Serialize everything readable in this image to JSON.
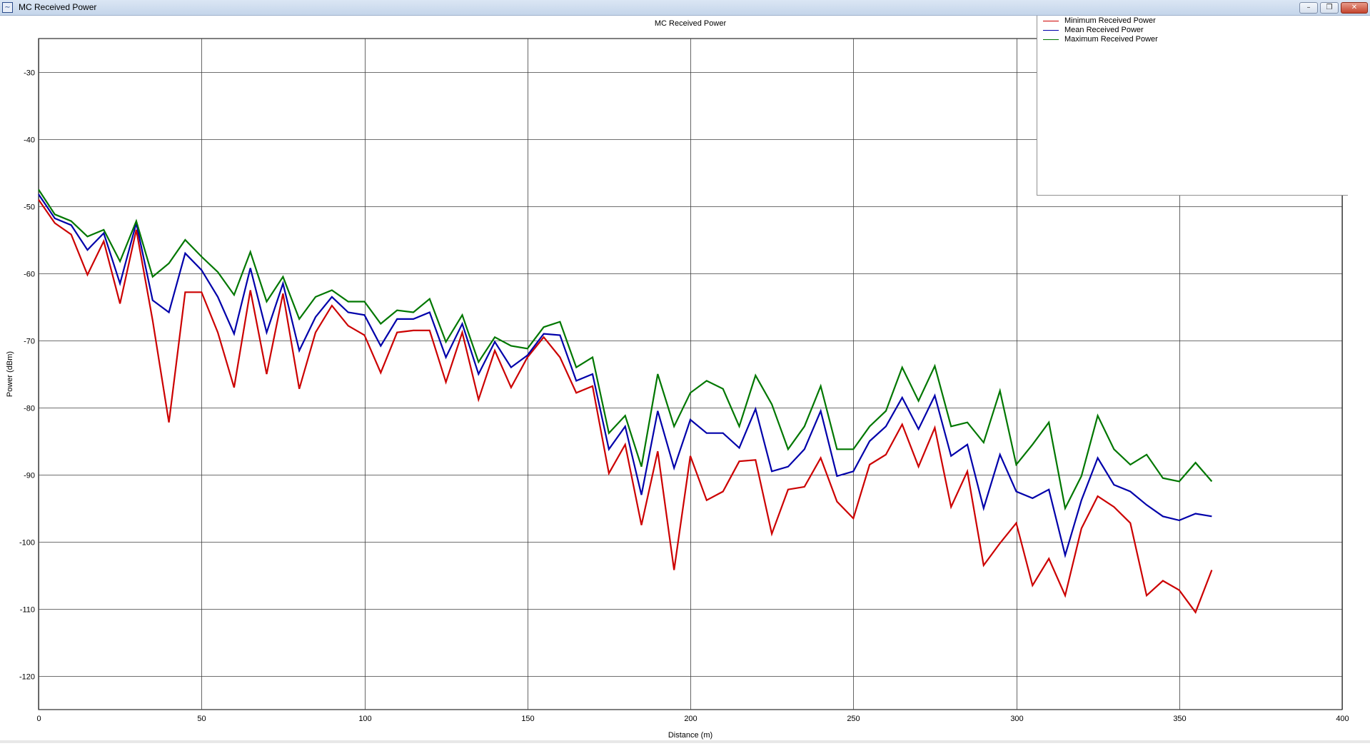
{
  "window": {
    "title": "MC Received Power",
    "minimize_glyph": "–",
    "restore_glyph": "❐",
    "close_glyph": "✕"
  },
  "colors": {
    "min": "#cc0000",
    "mean": "#0000aa",
    "max": "#007700",
    "grid": "#404040"
  },
  "chart_data": {
    "type": "line",
    "title": "MC Received Power",
    "xlabel": "Distance (m)",
    "ylabel": "Power (dBm)",
    "xlim": [
      0,
      400
    ],
    "ylim": [
      -125,
      -25
    ],
    "xticks": [
      0,
      50,
      100,
      150,
      200,
      250,
      300,
      350,
      400
    ],
    "yticks": [
      -30,
      -40,
      -50,
      -60,
      -70,
      -80,
      -90,
      -100,
      -110,
      -120
    ],
    "grid": true,
    "legend_position": "top-right",
    "x": [
      0,
      5,
      10,
      15,
      20,
      25,
      30,
      35,
      40,
      45,
      50,
      55,
      60,
      65,
      70,
      75,
      80,
      85,
      90,
      95,
      100,
      105,
      110,
      115,
      120,
      125,
      130,
      135,
      140,
      145,
      150,
      155,
      160,
      165,
      170,
      175,
      180,
      185,
      190,
      195,
      200,
      205,
      210,
      215,
      220,
      225,
      230,
      235,
      240,
      245,
      250,
      255,
      260,
      265,
      270,
      275,
      280,
      285,
      290,
      295,
      300,
      305,
      310,
      315,
      320,
      325,
      330,
      335,
      340,
      345,
      350,
      355,
      360
    ],
    "series": [
      {
        "name": "Minimum Received Power",
        "color": "#cc0000",
        "values": [
          -49,
          -52.5,
          -54.2,
          -60.2,
          -55.2,
          -64.5,
          -53.5,
          -67,
          -82.2,
          -62.8,
          -62.8,
          -68.8,
          -77,
          -62.5,
          -75,
          -63,
          -77.2,
          -68.8,
          -64.8,
          -67.8,
          -69.2,
          -74.8,
          -68.8,
          -68.5,
          -68.5,
          -76.2,
          -68.8,
          -78.8,
          -71.5,
          -77,
          -72.5,
          -69.5,
          -72.5,
          -77.8,
          -76.8,
          -89.8,
          -85.5,
          -97.5,
          -86.5,
          -104.2,
          -87.2,
          -93.8,
          -92.5,
          -88,
          -87.8,
          -98.8,
          -92.2,
          -91.8,
          -87.5,
          -94,
          -96.5,
          -88.5,
          -87,
          -82.5,
          -88.8,
          -83,
          -94.8,
          -89.5,
          -103.5,
          -100.2,
          -97.2,
          -106.5,
          -102.5,
          -108,
          -98,
          -93.2,
          -94.8,
          -97.2,
          -108,
          -105.8,
          -107.2,
          -110.5,
          -104.2
        ]
      },
      {
        "name": "Mean Received Power",
        "color": "#0000aa",
        "values": [
          -48.2,
          -51.8,
          -52.8,
          -56.5,
          -54,
          -61.5,
          -52.5,
          -64,
          -65.8,
          -57,
          -59.5,
          -63.5,
          -69,
          -59.2,
          -68.8,
          -61.5,
          -71.5,
          -66.5,
          -63.5,
          -65.8,
          -66.2,
          -70.8,
          -66.8,
          -66.8,
          -65.8,
          -72.5,
          -67.5,
          -75,
          -70.2,
          -74,
          -72.2,
          -69,
          -69.2,
          -76,
          -75,
          -86.2,
          -82.8,
          -93,
          -80.5,
          -89,
          -81.8,
          -83.8,
          -83.8,
          -86,
          -80.2,
          -89.5,
          -88.8,
          -86.2,
          -80.5,
          -90.2,
          -89.5,
          -85,
          -82.8,
          -78.5,
          -83.2,
          -78.2,
          -87.2,
          -85.5,
          -95,
          -87,
          -92.5,
          -93.5,
          -92.2,
          -102,
          -93.8,
          -87.5,
          -91.5,
          -92.5,
          -94.5,
          -96.2,
          -96.8,
          -95.8,
          -96.2
        ]
      },
      {
        "name": "Maximum Received Power",
        "color": "#007700",
        "values": [
          -47.5,
          -51.2,
          -52.2,
          -54.5,
          -53.5,
          -58.2,
          -52.2,
          -60.5,
          -58.5,
          -55,
          -57.5,
          -59.8,
          -63.2,
          -56.8,
          -64.2,
          -60.5,
          -66.8,
          -63.5,
          -62.5,
          -64.2,
          -64.2,
          -67.5,
          -65.5,
          -65.8,
          -63.8,
          -70.2,
          -66.2,
          -73.2,
          -69.5,
          -70.8,
          -71.2,
          -68,
          -67.2,
          -74,
          -72.5,
          -83.8,
          -81.2,
          -88.8,
          -75,
          -82.8,
          -77.8,
          -76,
          -77.2,
          -82.8,
          -75.2,
          -79.5,
          -86.2,
          -82.8,
          -76.8,
          -86.2,
          -86.2,
          -82.8,
          -80.5,
          -74,
          -79,
          -73.8,
          -82.8,
          -82.2,
          -85.2,
          -77.5,
          -88.5,
          -85.5,
          -82.2,
          -95,
          -90.2,
          -81.2,
          -86.2,
          -88.5,
          -87,
          -90.5,
          -91,
          -88.2,
          -91
        ]
      }
    ]
  }
}
